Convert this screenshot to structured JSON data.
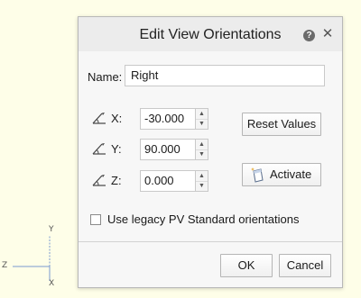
{
  "triad": {
    "y_label": "Y",
    "z_label": "Z",
    "x_label": "X"
  },
  "dialog": {
    "title": "Edit View Orientations",
    "help_icon": "help-icon",
    "close_icon": "close-icon",
    "help_glyph": "?",
    "close_glyph": "✕",
    "name_label": "Name:",
    "name_value": "Right",
    "axes": [
      {
        "label": "X:",
        "value": "-30.000",
        "icon": "angle-icon"
      },
      {
        "label": "Y:",
        "value": "90.000",
        "icon": "angle-icon"
      },
      {
        "label": "Z:",
        "value": "0.000",
        "icon": "angle-icon"
      }
    ],
    "spin_up_glyph": "▲",
    "spin_down_glyph": "▼",
    "reset_label": "Reset Values",
    "activate_label": "Activate",
    "activate_icon": "activate-icon",
    "checkbox_label": "Use legacy PV Standard orientations",
    "checkbox_checked": false,
    "ok_label": "OK",
    "cancel_label": "Cancel"
  }
}
